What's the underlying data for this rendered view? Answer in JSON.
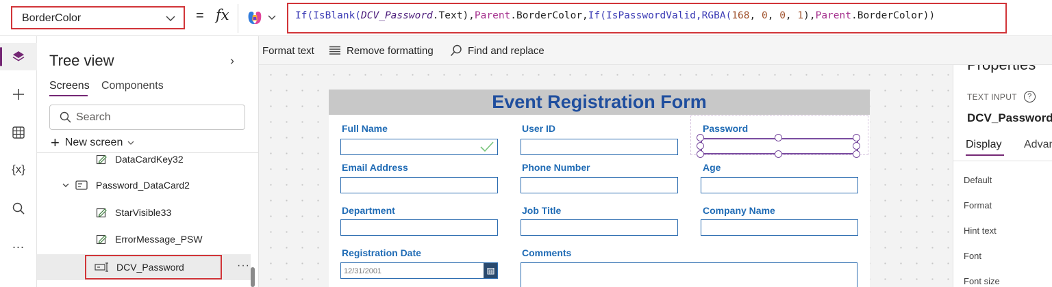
{
  "formula_bar": {
    "property": "BorderColor",
    "equals": "=",
    "fx": "fx",
    "formula_tokens": [
      {
        "t": "If(IsBlank(",
        "c": "kw"
      },
      {
        "t": "DCV_Password",
        "c": "it"
      },
      {
        "t": ".Text),",
        "c": ""
      },
      {
        "t": "Parent",
        "c": "pr"
      },
      {
        "t": ".BorderColor,",
        "c": ""
      },
      {
        "t": "If(IsPasswordValid,RGBA(",
        "c": "kw"
      },
      {
        "t": "168",
        "c": "nm"
      },
      {
        "t": ", ",
        "c": ""
      },
      {
        "t": "0",
        "c": "nm"
      },
      {
        "t": ", ",
        "c": ""
      },
      {
        "t": "0",
        "c": "nm"
      },
      {
        "t": ", ",
        "c": ""
      },
      {
        "t": "1",
        "c": "nm"
      },
      {
        "t": "),",
        "c": ""
      },
      {
        "t": "Parent",
        "c": "pr"
      },
      {
        "t": ".BorderColor))",
        "c": ""
      }
    ]
  },
  "toolbar": {
    "format_text": "Format text",
    "remove_formatting": "Remove formatting",
    "find_replace": "Find and replace"
  },
  "left_rail": {
    "variables_label": "{x}",
    "more_label": "..."
  },
  "tree": {
    "title": "Tree view",
    "collapse": "›",
    "tab_screens": "Screens",
    "tab_components": "Components",
    "search_placeholder": "Search",
    "new_screen": "New screen",
    "nodes": {
      "datacardkey32": "DataCardKey32",
      "password_datacard2": "Password_DataCard2",
      "starvisible33": "StarVisible33",
      "errormessage_psw": "ErrorMessage_PSW",
      "dcv_password": "DCV_Password"
    },
    "more": "···"
  },
  "form": {
    "title": "Event Registration Form",
    "labels": {
      "full_name": "Full Name",
      "user_id": "User ID",
      "password": "Password",
      "email": "Email Address",
      "phone": "Phone Number",
      "age": "Age",
      "department": "Department",
      "job_title": "Job Title",
      "company": "Company Name",
      "reg_date": "Registration Date",
      "comments": "Comments"
    },
    "reg_date_value": "12/31/2001"
  },
  "properties": {
    "title": "Properties",
    "control_type": "TEXT INPUT",
    "help": "?",
    "control_name": "DCV_Password",
    "tab_display": "Display",
    "tab_advanced": "Advanced",
    "rows": {
      "default": "Default",
      "format": "Format",
      "hint": "Hint text",
      "font": "Font",
      "font_size": "Font size"
    }
  },
  "colors": {
    "accent": "#742774",
    "highlight": "#d13438",
    "form_title": "#1f4e9e",
    "field_label": "#1f6bb5"
  }
}
